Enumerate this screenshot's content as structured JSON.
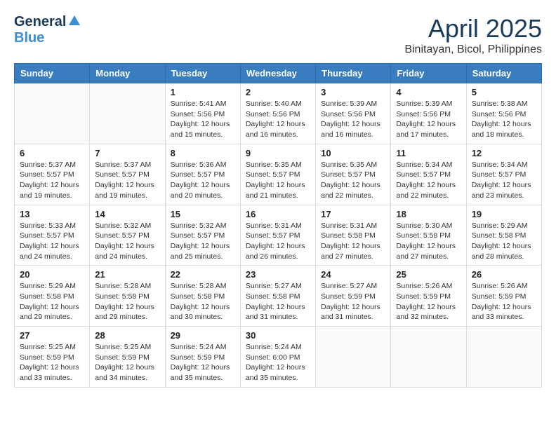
{
  "header": {
    "logo_general": "General",
    "logo_blue": "Blue",
    "main_title": "April 2025",
    "subtitle": "Binitayan, Bicol, Philippines"
  },
  "calendar": {
    "days_of_week": [
      "Sunday",
      "Monday",
      "Tuesday",
      "Wednesday",
      "Thursday",
      "Friday",
      "Saturday"
    ],
    "weeks": [
      [
        {
          "day": "",
          "sunrise": "",
          "sunset": "",
          "daylight": "",
          "empty": true
        },
        {
          "day": "",
          "sunrise": "",
          "sunset": "",
          "daylight": "",
          "empty": true
        },
        {
          "day": "1",
          "sunrise": "Sunrise: 5:41 AM",
          "sunset": "Sunset: 5:56 PM",
          "daylight": "Daylight: 12 hours and 15 minutes.",
          "empty": false
        },
        {
          "day": "2",
          "sunrise": "Sunrise: 5:40 AM",
          "sunset": "Sunset: 5:56 PM",
          "daylight": "Daylight: 12 hours and 16 minutes.",
          "empty": false
        },
        {
          "day": "3",
          "sunrise": "Sunrise: 5:39 AM",
          "sunset": "Sunset: 5:56 PM",
          "daylight": "Daylight: 12 hours and 16 minutes.",
          "empty": false
        },
        {
          "day": "4",
          "sunrise": "Sunrise: 5:39 AM",
          "sunset": "Sunset: 5:56 PM",
          "daylight": "Daylight: 12 hours and 17 minutes.",
          "empty": false
        },
        {
          "day": "5",
          "sunrise": "Sunrise: 5:38 AM",
          "sunset": "Sunset: 5:56 PM",
          "daylight": "Daylight: 12 hours and 18 minutes.",
          "empty": false
        }
      ],
      [
        {
          "day": "6",
          "sunrise": "Sunrise: 5:37 AM",
          "sunset": "Sunset: 5:57 PM",
          "daylight": "Daylight: 12 hours and 19 minutes.",
          "empty": false
        },
        {
          "day": "7",
          "sunrise": "Sunrise: 5:37 AM",
          "sunset": "Sunset: 5:57 PM",
          "daylight": "Daylight: 12 hours and 19 minutes.",
          "empty": false
        },
        {
          "day": "8",
          "sunrise": "Sunrise: 5:36 AM",
          "sunset": "Sunset: 5:57 PM",
          "daylight": "Daylight: 12 hours and 20 minutes.",
          "empty": false
        },
        {
          "day": "9",
          "sunrise": "Sunrise: 5:35 AM",
          "sunset": "Sunset: 5:57 PM",
          "daylight": "Daylight: 12 hours and 21 minutes.",
          "empty": false
        },
        {
          "day": "10",
          "sunrise": "Sunrise: 5:35 AM",
          "sunset": "Sunset: 5:57 PM",
          "daylight": "Daylight: 12 hours and 22 minutes.",
          "empty": false
        },
        {
          "day": "11",
          "sunrise": "Sunrise: 5:34 AM",
          "sunset": "Sunset: 5:57 PM",
          "daylight": "Daylight: 12 hours and 22 minutes.",
          "empty": false
        },
        {
          "day": "12",
          "sunrise": "Sunrise: 5:34 AM",
          "sunset": "Sunset: 5:57 PM",
          "daylight": "Daylight: 12 hours and 23 minutes.",
          "empty": false
        }
      ],
      [
        {
          "day": "13",
          "sunrise": "Sunrise: 5:33 AM",
          "sunset": "Sunset: 5:57 PM",
          "daylight": "Daylight: 12 hours and 24 minutes.",
          "empty": false
        },
        {
          "day": "14",
          "sunrise": "Sunrise: 5:32 AM",
          "sunset": "Sunset: 5:57 PM",
          "daylight": "Daylight: 12 hours and 24 minutes.",
          "empty": false
        },
        {
          "day": "15",
          "sunrise": "Sunrise: 5:32 AM",
          "sunset": "Sunset: 5:57 PM",
          "daylight": "Daylight: 12 hours and 25 minutes.",
          "empty": false
        },
        {
          "day": "16",
          "sunrise": "Sunrise: 5:31 AM",
          "sunset": "Sunset: 5:57 PM",
          "daylight": "Daylight: 12 hours and 26 minutes.",
          "empty": false
        },
        {
          "day": "17",
          "sunrise": "Sunrise: 5:31 AM",
          "sunset": "Sunset: 5:58 PM",
          "daylight": "Daylight: 12 hours and 27 minutes.",
          "empty": false
        },
        {
          "day": "18",
          "sunrise": "Sunrise: 5:30 AM",
          "sunset": "Sunset: 5:58 PM",
          "daylight": "Daylight: 12 hours and 27 minutes.",
          "empty": false
        },
        {
          "day": "19",
          "sunrise": "Sunrise: 5:29 AM",
          "sunset": "Sunset: 5:58 PM",
          "daylight": "Daylight: 12 hours and 28 minutes.",
          "empty": false
        }
      ],
      [
        {
          "day": "20",
          "sunrise": "Sunrise: 5:29 AM",
          "sunset": "Sunset: 5:58 PM",
          "daylight": "Daylight: 12 hours and 29 minutes.",
          "empty": false
        },
        {
          "day": "21",
          "sunrise": "Sunrise: 5:28 AM",
          "sunset": "Sunset: 5:58 PM",
          "daylight": "Daylight: 12 hours and 29 minutes.",
          "empty": false
        },
        {
          "day": "22",
          "sunrise": "Sunrise: 5:28 AM",
          "sunset": "Sunset: 5:58 PM",
          "daylight": "Daylight: 12 hours and 30 minutes.",
          "empty": false
        },
        {
          "day": "23",
          "sunrise": "Sunrise: 5:27 AM",
          "sunset": "Sunset: 5:58 PM",
          "daylight": "Daylight: 12 hours and 31 minutes.",
          "empty": false
        },
        {
          "day": "24",
          "sunrise": "Sunrise: 5:27 AM",
          "sunset": "Sunset: 5:59 PM",
          "daylight": "Daylight: 12 hours and 31 minutes.",
          "empty": false
        },
        {
          "day": "25",
          "sunrise": "Sunrise: 5:26 AM",
          "sunset": "Sunset: 5:59 PM",
          "daylight": "Daylight: 12 hours and 32 minutes.",
          "empty": false
        },
        {
          "day": "26",
          "sunrise": "Sunrise: 5:26 AM",
          "sunset": "Sunset: 5:59 PM",
          "daylight": "Daylight: 12 hours and 33 minutes.",
          "empty": false
        }
      ],
      [
        {
          "day": "27",
          "sunrise": "Sunrise: 5:25 AM",
          "sunset": "Sunset: 5:59 PM",
          "daylight": "Daylight: 12 hours and 33 minutes.",
          "empty": false
        },
        {
          "day": "28",
          "sunrise": "Sunrise: 5:25 AM",
          "sunset": "Sunset: 5:59 PM",
          "daylight": "Daylight: 12 hours and 34 minutes.",
          "empty": false
        },
        {
          "day": "29",
          "sunrise": "Sunrise: 5:24 AM",
          "sunset": "Sunset: 5:59 PM",
          "daylight": "Daylight: 12 hours and 35 minutes.",
          "empty": false
        },
        {
          "day": "30",
          "sunrise": "Sunrise: 5:24 AM",
          "sunset": "Sunset: 6:00 PM",
          "daylight": "Daylight: 12 hours and 35 minutes.",
          "empty": false
        },
        {
          "day": "",
          "sunrise": "",
          "sunset": "",
          "daylight": "",
          "empty": true
        },
        {
          "day": "",
          "sunrise": "",
          "sunset": "",
          "daylight": "",
          "empty": true
        },
        {
          "day": "",
          "sunrise": "",
          "sunset": "",
          "daylight": "",
          "empty": true
        }
      ]
    ]
  }
}
